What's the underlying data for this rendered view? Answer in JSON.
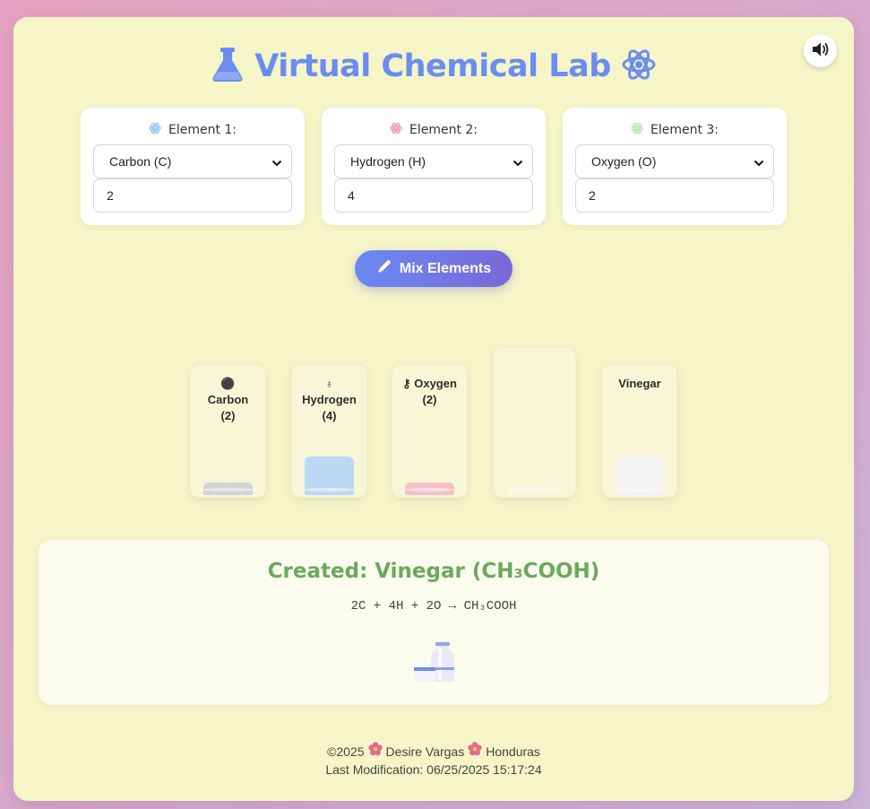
{
  "title": "Virtual Chemical Lab",
  "elements": [
    {
      "label": "Element 1:",
      "selected": "Carbon (C)",
      "quantity": "2",
      "icon_color": "#9cc8f0"
    },
    {
      "label": "Element 2:",
      "selected": "Hydrogen (H)",
      "quantity": "4",
      "icon_color": "#f0a0b4"
    },
    {
      "label": "Element 3:",
      "selected": "Oxygen (O)",
      "quantity": "2",
      "icon_color": "#b8e6b8"
    }
  ],
  "mix_button": "Mix Elements",
  "beakers": [
    {
      "symbol": "⚫",
      "name": "Carbon",
      "qty": "(2)",
      "liquid_color": "#d3d3d3"
    },
    {
      "symbol": "♁",
      "name": "Hydrogen",
      "qty": "(4)",
      "liquid_color": "#bcd8f4"
    },
    {
      "symbol": "⚷",
      "name": "Oxygen",
      "qty": "(2)",
      "liquid_color": "#f4c0c8"
    },
    {
      "symbol": "",
      "name": "",
      "qty": "",
      "liquid_color": "#f7f7dc"
    },
    {
      "symbol": "",
      "name": "Vinegar",
      "qty": "",
      "liquid_color": "#f2f2f2"
    }
  ],
  "result": {
    "title": "Created: Vinegar (CH₃COOH)",
    "equation": "2C + 4H + 2O → CH₃COOH"
  },
  "footer": {
    "copyright": "©2025",
    "author": "Desire Vargas",
    "country": "Honduras",
    "modified": "Last Modification: 06/25/2025 15:17:24"
  },
  "colors": {
    "accent": "#6b8df0",
    "result_title": "#6aaa5b",
    "flower": "#e06b8f"
  }
}
